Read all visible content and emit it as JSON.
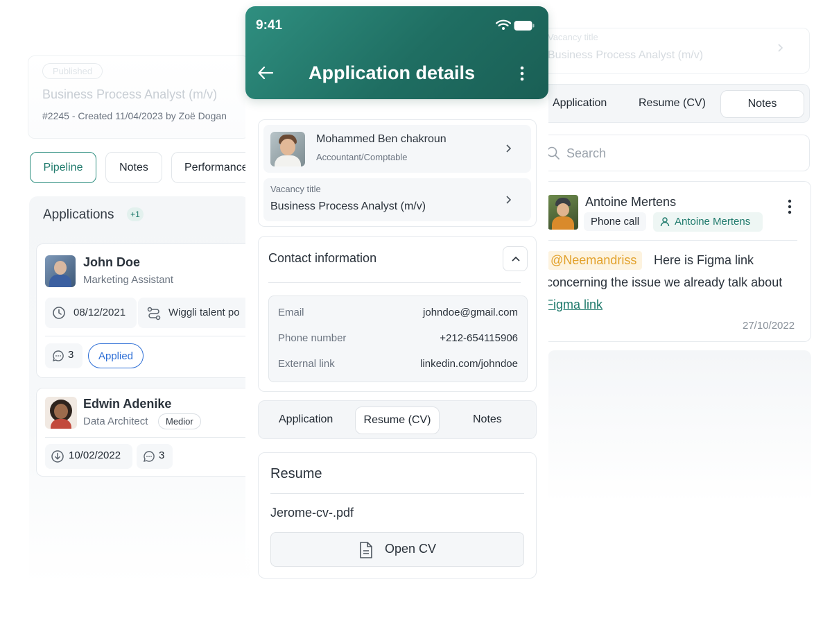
{
  "left": {
    "status_badge": "Published",
    "job_title": "Business Process Analyst (m/v)",
    "job_meta": "#2245 - Created 11/04/2023 by Zoë Dogan",
    "tabs": [
      {
        "label": "Pipeline"
      },
      {
        "label": "Notes"
      },
      {
        "label": "Performance"
      }
    ],
    "applications_title": "Applications",
    "applications_count": "+1",
    "candidates": [
      {
        "name": "John Doe",
        "role": "Marketing Assistant",
        "date": "08/12/2021",
        "source": "Wiggli talent po",
        "comments": "3",
        "status": "Applied"
      },
      {
        "name": "Edwin Adenike",
        "role": "Data Architect",
        "level": "Medior",
        "date": "10/02/2022",
        "comments": "3"
      }
    ]
  },
  "phone": {
    "time": "9:41",
    "title": "Application details",
    "candidate": {
      "name": "Mohammed Ben chakroun",
      "role": "Accountant/Comptable"
    },
    "vacancy": {
      "label": "Vacancy title",
      "value": "Business Process Analyst (m/v)"
    },
    "contact": {
      "title": "Contact information",
      "rows": [
        {
          "label": "Email",
          "value": "johndoe@gmail.com"
        },
        {
          "label": "Phone number",
          "value": "+212-654115906"
        },
        {
          "label": "External link",
          "value": "linkedin.com/johndoe"
        }
      ]
    },
    "tabs": [
      {
        "label": "Application"
      },
      {
        "label": "Resume (CV)"
      },
      {
        "label": "Notes"
      }
    ],
    "resume": {
      "title": "Resume",
      "file": "Jerome-cv-.pdf",
      "open_label": "Open CV"
    }
  },
  "right": {
    "faded_label": "Vacancy title",
    "faded_value": "Business Process Analyst (m/v)",
    "tabs": [
      {
        "label": "Application"
      },
      {
        "label": "Resume (CV)"
      },
      {
        "label": "Notes"
      }
    ],
    "search_placeholder": "Search",
    "note": {
      "author": "Antoine Mertens",
      "tag_phone": "Phone call",
      "tag_person": "Antoine Mertens",
      "mention": "@Neemandriss",
      "text_1": "Here is Figma link",
      "text_2": "concerning the issue we already talk about",
      "link": "Figma link",
      "date": "27/10/2022"
    }
  },
  "colors": {
    "brand": "#1f7a6c",
    "mention_bg": "#fdf3df",
    "mention_text": "#e2a12b",
    "applied_blue": "#2e6fd6"
  }
}
